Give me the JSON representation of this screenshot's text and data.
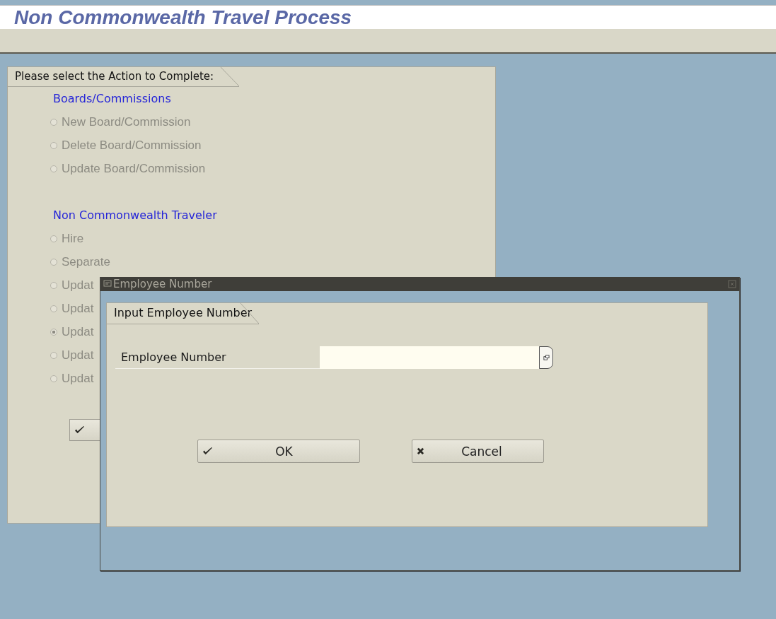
{
  "title": "Non Commonwealth Travel Process",
  "panel": {
    "header": "Please select the Action to Complete:",
    "groups": [
      {
        "heading": "Boards/Commissions",
        "options": [
          {
            "label": "New Board/Commission",
            "selected": false,
            "disabled": true
          },
          {
            "label": "Delete Board/Commission",
            "selected": false,
            "disabled": true
          },
          {
            "label": "Update Board/Commission",
            "selected": false,
            "disabled": true
          }
        ]
      },
      {
        "heading": "Non Commonwealth Traveler",
        "options": [
          {
            "label": "Hire",
            "selected": false,
            "disabled": true
          },
          {
            "label": "Separate",
            "selected": false,
            "disabled": true
          },
          {
            "label": "Updat",
            "selected": false,
            "disabled": true
          },
          {
            "label": "Updat",
            "selected": false,
            "disabled": true
          },
          {
            "label": "Updat",
            "selected": true,
            "disabled": true
          },
          {
            "label": "Updat",
            "selected": false,
            "disabled": true
          },
          {
            "label": "Updat",
            "selected": false,
            "disabled": true
          }
        ]
      }
    ]
  },
  "dialog": {
    "title": "Employee Number",
    "section": "Input Employee Number",
    "field": {
      "label": "Employee Number"
    },
    "buttons": [
      {
        "label": "OK",
        "kind": "ok"
      },
      {
        "label": "Cancel",
        "kind": "cancel"
      }
    ]
  }
}
